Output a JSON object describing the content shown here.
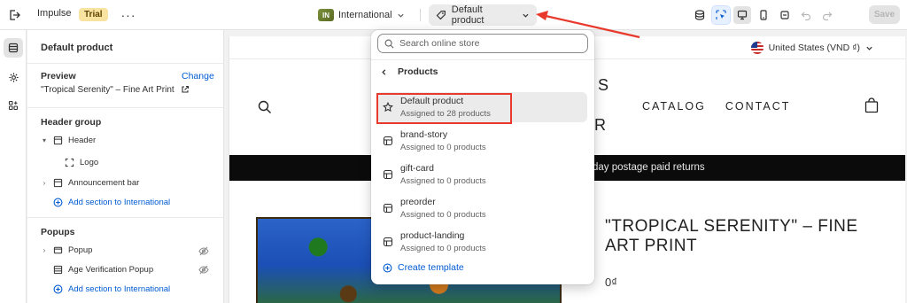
{
  "topbar": {
    "theme_name": "Impulse",
    "trial_badge": "Trial",
    "more_label": "···",
    "market": {
      "code": "IN",
      "label": "International"
    },
    "template_selector": "Default product",
    "save_label": "Save"
  },
  "sidebar": {
    "title": "Default product",
    "preview": {
      "label": "Preview",
      "change_link": "Change",
      "product": "\"Tropical Serenity\" – Fine Art Print"
    },
    "header_group": {
      "label": "Header group",
      "items": [
        {
          "label": "Header"
        },
        {
          "label": "Logo"
        },
        {
          "label": "Announcement bar"
        }
      ],
      "add_section": "Add section to International"
    },
    "popups": {
      "label": "Popups",
      "items": [
        {
          "label": "Popup"
        },
        {
          "label": "Age Verification Popup"
        }
      ],
      "add_section": "Add section to International"
    }
  },
  "dropdown": {
    "search_placeholder": "Search online store",
    "back_label": "Products",
    "templates": [
      {
        "name": "Default product",
        "assigned": "Assigned to 28 products",
        "selected": true
      },
      {
        "name": "brand-story",
        "assigned": "Assigned to 0 products"
      },
      {
        "name": "gift-card",
        "assigned": "Assigned to 0 products"
      },
      {
        "name": "preorder",
        "assigned": "Assigned to 0 products"
      },
      {
        "name": "product-landing",
        "assigned": "Assigned to 0 products"
      }
    ],
    "create_label": "Create template"
  },
  "preview": {
    "locale": "United States (VND ₫)",
    "nav": [
      "CATALOG",
      "CONTACT"
    ],
    "logo_fragment_top": "S",
    "logo_fragment_bottom": "R",
    "announcement": "day postage paid returns",
    "product_title": "\"TROPICAL SERENITY\" – FINE ART PRINT",
    "price": "0₫"
  },
  "colors": {
    "accent_link": "#005bd3",
    "annotation_red": "#e8392c",
    "trial_badge_bg": "#f9e3a0"
  }
}
